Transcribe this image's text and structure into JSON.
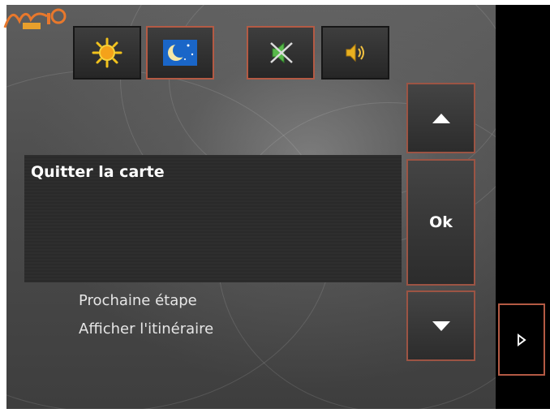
{
  "app": {
    "brand": "Mio"
  },
  "toolbar": {
    "buttons": [
      {
        "name": "day-mode",
        "icon": "sun-icon",
        "active": false
      },
      {
        "name": "night-mode",
        "icon": "moon-icon",
        "active": true
      },
      {
        "name": "mute",
        "icon": "speaker-muted-icon",
        "active": true
      },
      {
        "name": "sound-on",
        "icon": "speaker-icon",
        "active": false
      }
    ]
  },
  "menu": {
    "selected_item": "Quitter la carte",
    "items": [
      "Prochaine étape",
      "Afficher l'itinéraire"
    ]
  },
  "controls": {
    "ok_label": "Ok"
  },
  "colors": {
    "accent_border": "#b45a44",
    "panel_bg": "#4c4c4c",
    "list_bg": "#2e2e2e",
    "strip_bg": "#000000"
  }
}
